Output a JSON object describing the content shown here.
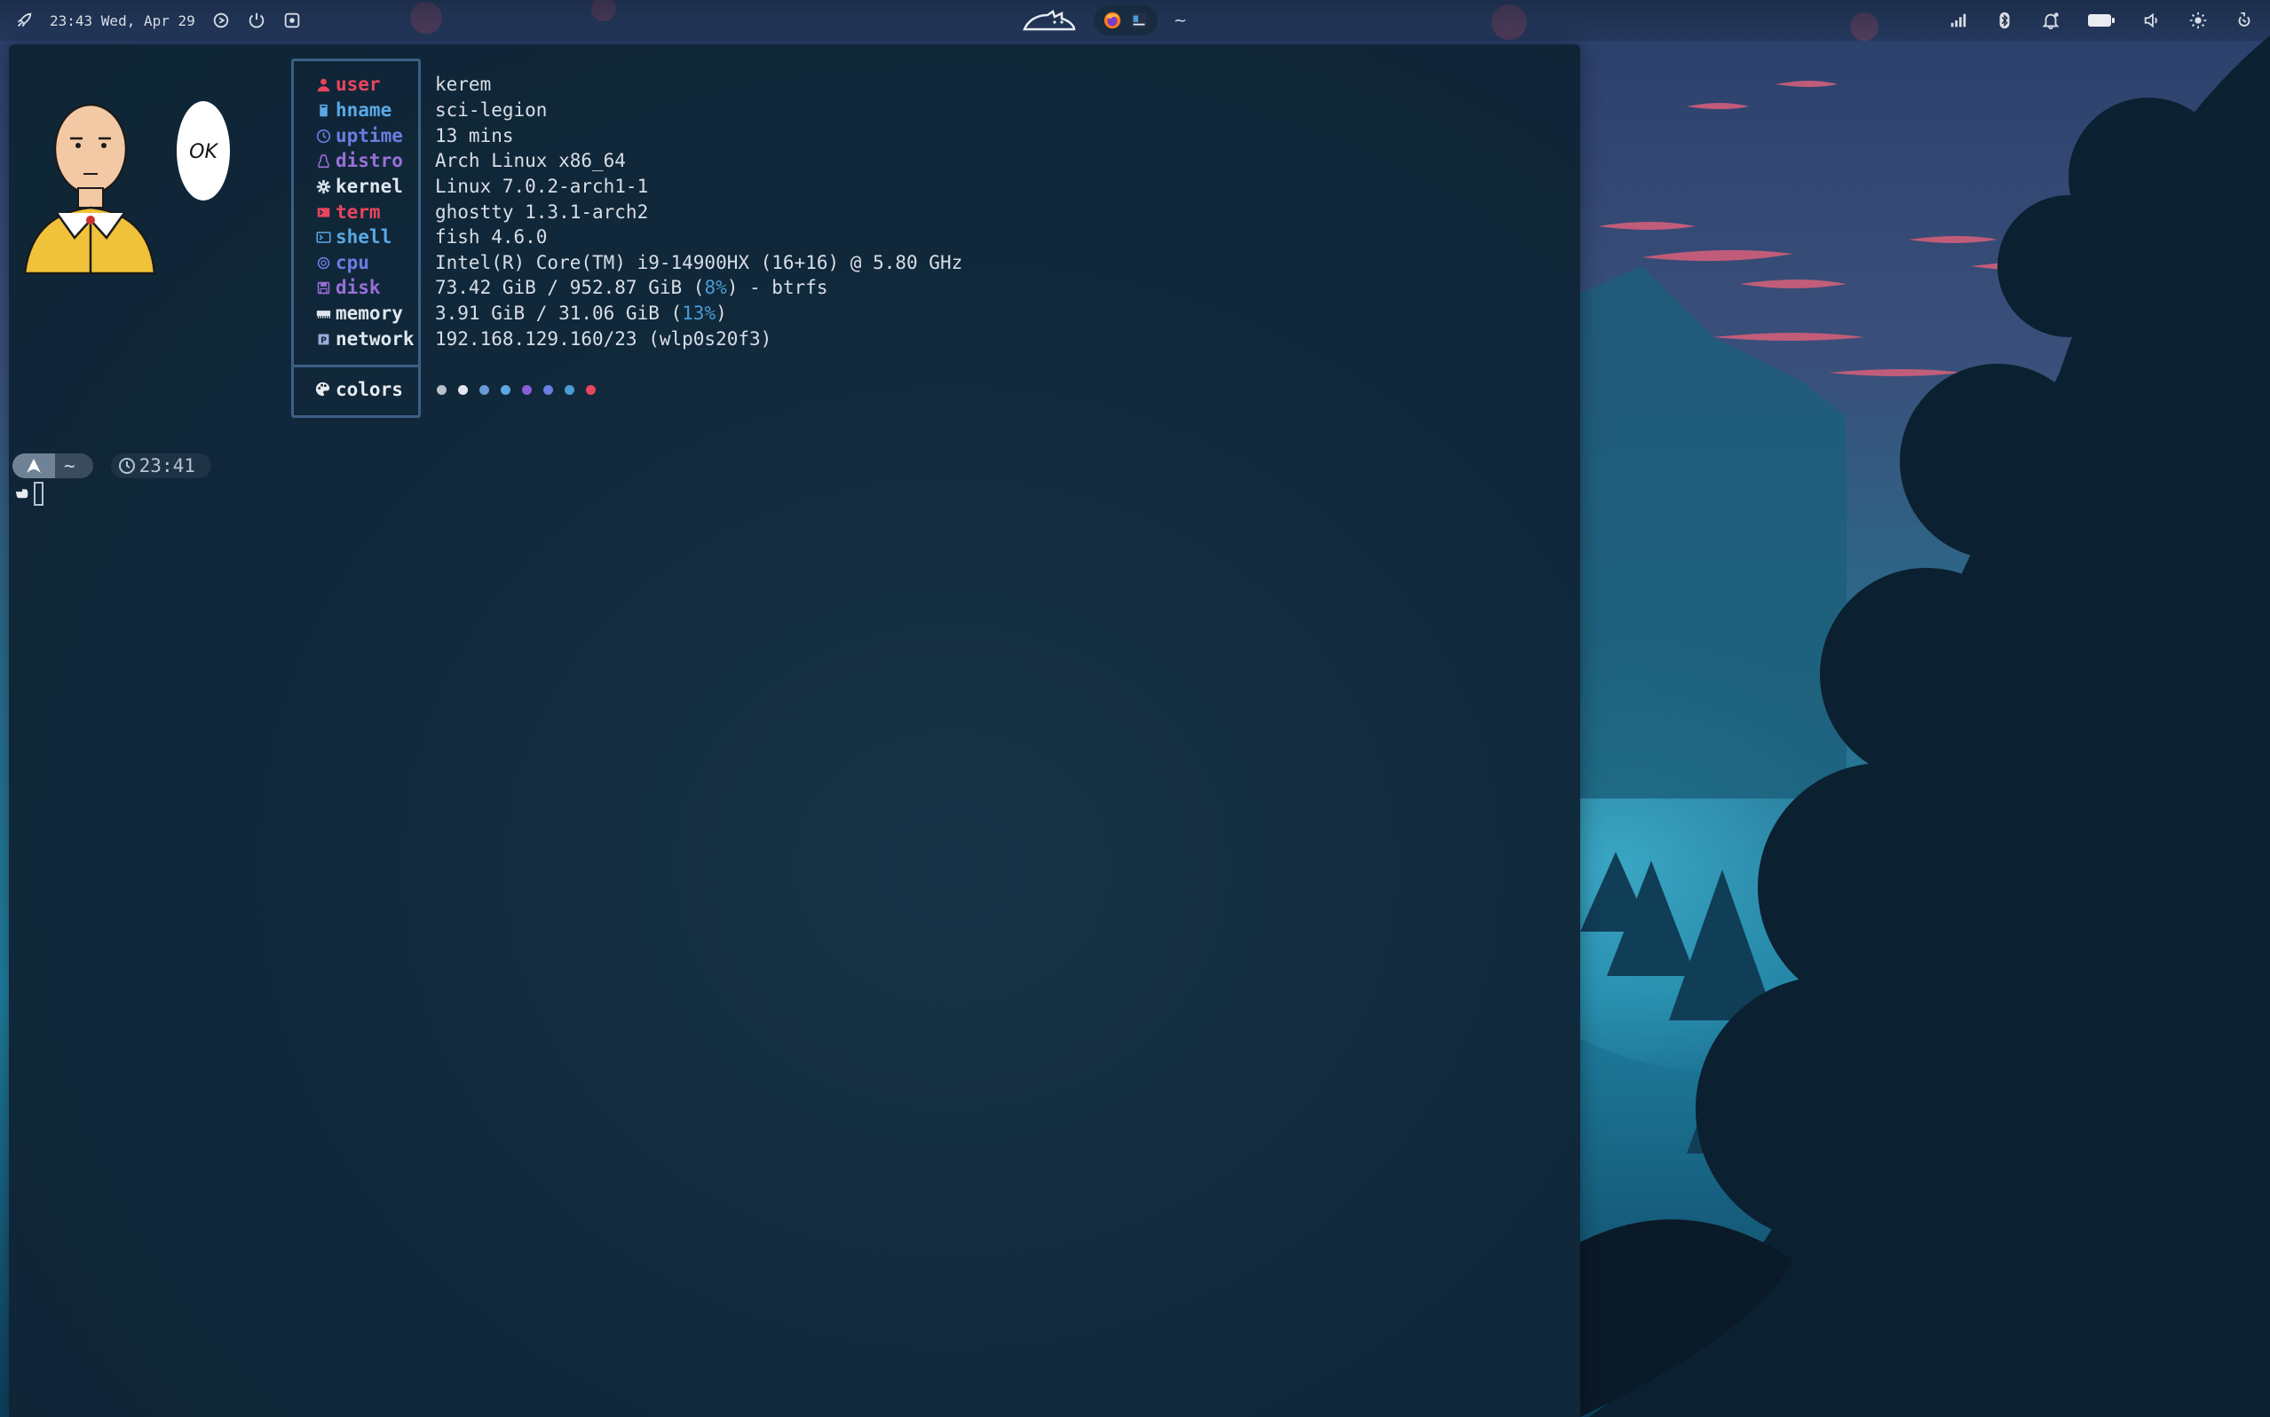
{
  "topbar": {
    "datetime": "23:43 Wed, Apr 29",
    "left_icons": [
      "launcher-icon",
      "recording-icon",
      "idle-inhibit-icon",
      "screenshot-icon"
    ],
    "workspace_char": "~",
    "apps": [
      "firefox-icon",
      "terminal-icon"
    ],
    "right_icons": [
      "wifi-icon",
      "bluetooth-icon",
      "notification-icon",
      "battery-icon",
      "volume-icon",
      "brightness-icon",
      "power-icon"
    ]
  },
  "speech_bubble": "OK",
  "fetch": {
    "rows": [
      {
        "key": "user",
        "value": "kerem",
        "icon": "user-icon",
        "color": "#e8455e"
      },
      {
        "key": "hname",
        "value": "sci-legion",
        "icon": "host-icon",
        "color": "#5aa9e6"
      },
      {
        "key": "uptime",
        "value": "13 mins",
        "icon": "clock-icon",
        "color": "#6a7de0"
      },
      {
        "key": "distro",
        "value": "Arch Linux x86_64",
        "icon": "linux-icon",
        "color": "#9a6fd8"
      },
      {
        "key": "kernel",
        "value": "Linux 7.0.2-arch1-1",
        "icon": "gear-icon",
        "color": "#dfe6ee"
      },
      {
        "key": "term",
        "value": "ghostty 1.3.1-arch2",
        "icon": "terminal-icon",
        "color": "#e8455e"
      },
      {
        "key": "shell",
        "value": "fish 4.6.0",
        "icon": "shell-icon",
        "color": "#5aa9e6"
      },
      {
        "key": "cpu",
        "value": "Intel(R) Core(TM) i9-14900HX (16+16) @ 5.80 GHz",
        "icon": "cpu-icon",
        "color": "#6a7de0"
      },
      {
        "key": "disk",
        "value": "73.42 GiB / 952.87 GiB (",
        "value_hl": "8%",
        "value_after": ") - btrfs",
        "icon": "disk-icon",
        "color": "#9a6fd8"
      },
      {
        "key": "memory",
        "value": "3.91 GiB / 31.06 GiB (",
        "value_hl": "13%",
        "value_after": ")",
        "icon": "memory-icon",
        "color": "#dfe6ee"
      },
      {
        "key": "network",
        "value": "192.168.129.160/23 (wlp0s20f3)",
        "icon": "network-icon",
        "color": "#dfe6ee"
      }
    ],
    "colors_label": "colors",
    "palette": [
      "#b9c2cc",
      "#e4e8ee",
      "#6a9ad6",
      "#5aa9e6",
      "#8a5fd8",
      "#6a7de0",
      "#4b9cd3",
      "#e8455e"
    ]
  },
  "prompt": {
    "dir": "~",
    "time": "23:41"
  }
}
